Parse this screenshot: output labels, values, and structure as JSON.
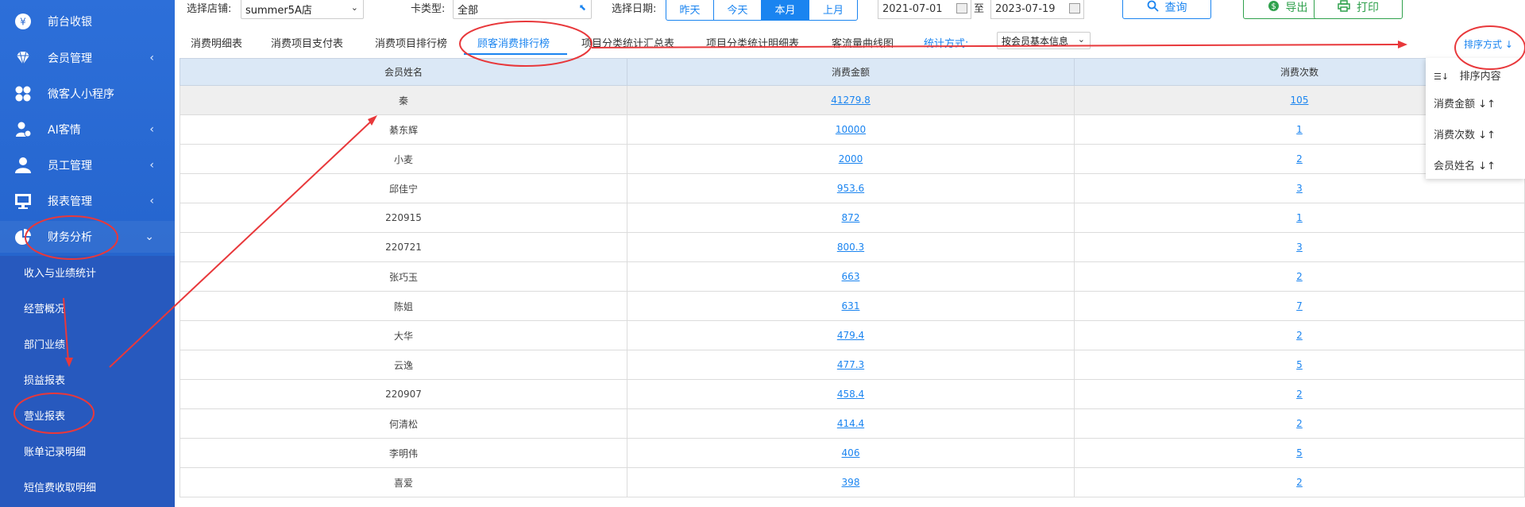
{
  "sidebar": {
    "items": [
      {
        "icon": "yen-icon",
        "glyph": "¥",
        "label": "前台收银",
        "chevron": false
      },
      {
        "icon": "diamond-icon",
        "glyph": "◆",
        "label": "会员管理",
        "chevron": true
      },
      {
        "icon": "apps-icon",
        "glyph": "✤",
        "label": "微客人小程序",
        "chevron": false
      },
      {
        "icon": "ai-person-icon",
        "glyph": "●",
        "label": "AI客情",
        "chevron": true
      },
      {
        "icon": "user-icon",
        "glyph": "●",
        "label": "员工管理",
        "chevron": true
      },
      {
        "icon": "monitor-icon",
        "glyph": "▣",
        "label": "报表管理",
        "chevron": true
      },
      {
        "icon": "pie-chart-icon",
        "glyph": "◕",
        "label": "财务分析",
        "chevron": true
      }
    ],
    "sub_items": [
      "收入与业绩统计",
      "经营概况",
      "部门业绩",
      "损益报表",
      "营业报表",
      "账单记录明细",
      "短信费收取明细"
    ]
  },
  "filters": {
    "store_label": "选择店铺:",
    "store_value": "summer5A店",
    "card_label": "卡类型:",
    "card_value": "全部",
    "date_label": "选择日期:",
    "periods": [
      "昨天",
      "今天",
      "本月",
      "上月"
    ],
    "active_period": "本月",
    "date_from": "2021-07-01",
    "date_sep": "至",
    "date_to": "2023-07-19",
    "query_label": "查询",
    "export_label": "导出",
    "print_label": "打印"
  },
  "tabs": {
    "items": [
      "消费明细表",
      "消费项目支付表",
      "消费项目排行榜",
      "顾客消费排行榜",
      "项目分类统计汇总表",
      "项目分类统计明细表",
      "客流量曲线图"
    ],
    "active": "顾客消费排行榜",
    "stat_label": "统计方式:",
    "stat_value": "按会员基本信息",
    "sort_label": "排序方式"
  },
  "table": {
    "headers": [
      "会员姓名",
      "消费金额",
      "消费次数"
    ],
    "rows": [
      [
        "秦",
        "41279.8",
        "105"
      ],
      [
        "綦东辉",
        "10000",
        "1"
      ],
      [
        "小麦",
        "2000",
        "2"
      ],
      [
        "邱佳宁",
        "953.6",
        "3"
      ],
      [
        "220915",
        "872",
        "1"
      ],
      [
        "220721",
        "800.3",
        "3"
      ],
      [
        "张巧玉",
        "663",
        "2"
      ],
      [
        "陈姐",
        "631",
        "7"
      ],
      [
        "大华",
        "479.4",
        "2"
      ],
      [
        "云逸",
        "477.3",
        "5"
      ],
      [
        "220907",
        "458.4",
        "2"
      ],
      [
        "何清松",
        "414.4",
        "2"
      ],
      [
        "李明伟",
        "406",
        "5"
      ],
      [
        "喜爱",
        "398",
        "2"
      ]
    ]
  },
  "sort_menu": {
    "title": "排序内容",
    "options": [
      "消费金额",
      "消费次数",
      "会员姓名"
    ]
  },
  "colors": {
    "accent": "#1a84f0",
    "sidebar": "#2666cf",
    "annotation": "#e8383b"
  }
}
